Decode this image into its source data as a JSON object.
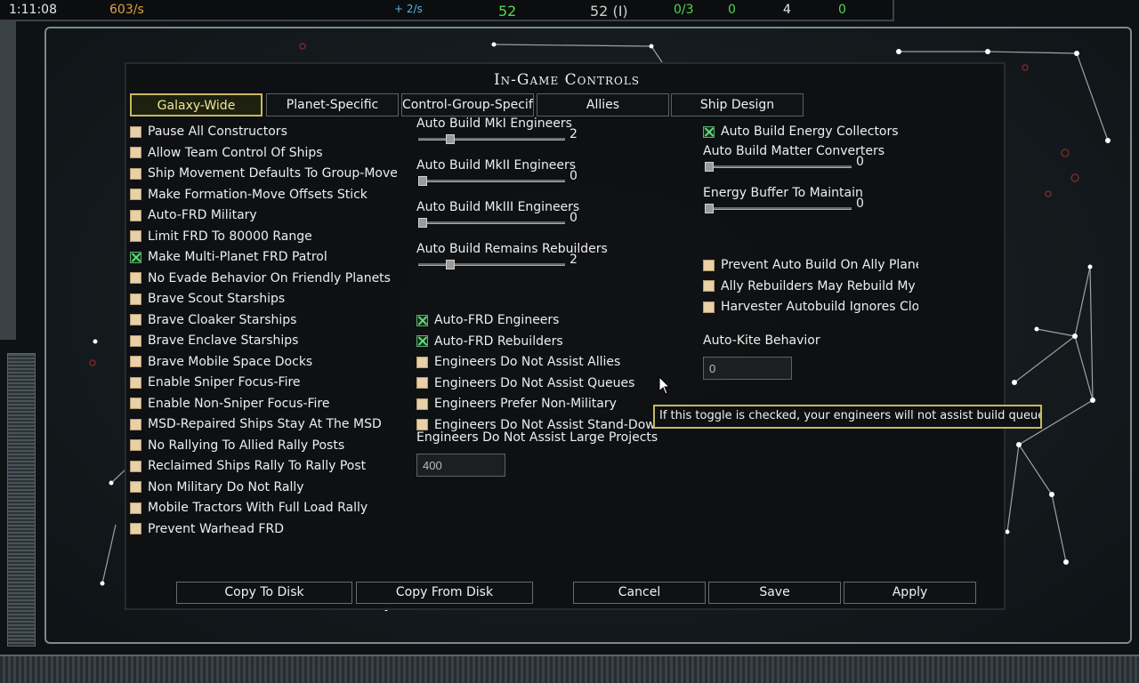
{
  "topbar": {
    "time": "1:11:08",
    "rate": "603/s",
    "energy_rate": "+ 2/s",
    "green_count": "52",
    "ship_count": "52 (I)",
    "ratio": "0/3",
    "zero_a": "0",
    "four": "4",
    "zero_b": "0"
  },
  "dialog": {
    "title": "In-Game Controls",
    "tabs": [
      "Galaxy-Wide",
      "Planet-Specific",
      "Control-Group-Specific",
      "Allies",
      "Ship Design"
    ],
    "col1": [
      {
        "label": "Pause All Constructors",
        "checked": false
      },
      {
        "label": "Allow Team Control Of Ships",
        "checked": false
      },
      {
        "label": "Ship Movement Defaults To Group-Move",
        "checked": false
      },
      {
        "label": "Make Formation-Move Offsets Stick",
        "checked": false
      },
      {
        "label": "Auto-FRD Military",
        "checked": false
      },
      {
        "label": "Limit FRD To 80000 Range",
        "checked": false
      },
      {
        "label": "Make Multi-Planet FRD Patrol",
        "checked": true
      },
      {
        "label": "No Evade Behavior On Friendly Planets",
        "checked": false
      },
      {
        "label": "Brave Scout Starships",
        "checked": false
      },
      {
        "label": "Brave Cloaker Starships",
        "checked": false
      },
      {
        "label": "Brave Enclave Starships",
        "checked": false
      },
      {
        "label": "Brave Mobile Space Docks",
        "checked": false
      },
      {
        "label": "Enable Sniper Focus-Fire",
        "checked": false
      },
      {
        "label": "Enable Non-Sniper Focus-Fire",
        "checked": false
      },
      {
        "label": "MSD-Repaired Ships Stay At The MSD",
        "checked": false
      },
      {
        "label": "No Rallying To Allied Rally Posts",
        "checked": false
      },
      {
        "label": "Reclaimed Ships Rally To Rally Post",
        "checked": false
      },
      {
        "label": "Non Military Do Not Rally",
        "checked": false
      },
      {
        "label": "Mobile Tractors With Full Load Rally",
        "checked": false
      },
      {
        "label": "Prevent Warhead FRD",
        "checked": false
      }
    ],
    "col2_sliders": [
      {
        "label": "Auto Build MkI Engineers",
        "value": "2",
        "fraction": 0.2
      },
      {
        "label": "Auto Build MkII Engineers",
        "value": "0",
        "fraction": 0
      },
      {
        "label": "Auto Build MkIII Engineers",
        "value": "0",
        "fraction": 0
      },
      {
        "label": "Auto Build Remains Rebuilders",
        "value": "2",
        "fraction": 0.2
      }
    ],
    "col2_checks": [
      {
        "label": "Auto-FRD Engineers",
        "checked": true
      },
      {
        "label": "Auto-FRD Rebuilders",
        "checked": true
      },
      {
        "label": "Engineers Do Not Assist Allies",
        "checked": false
      },
      {
        "label": "Engineers Do Not Assist Queues",
        "checked": false
      },
      {
        "label": "Engineers Prefer Non-Military",
        "checked": false
      },
      {
        "label": "Engineers Do Not Assist Stand-Down Sh",
        "checked": false
      }
    ],
    "large_projects": {
      "label": "Engineers Do Not Assist Large Projects",
      "value": "400"
    },
    "col3_energy": {
      "label": "Auto Build Energy Collectors",
      "checked": true
    },
    "col3_sliders": [
      {
        "label": "Auto Build Matter Converters",
        "value": "0",
        "fraction": 0
      },
      {
        "label": "Energy Buffer To Maintain",
        "value": "0",
        "fraction": 0
      }
    ],
    "col3_checks": [
      {
        "label": "Prevent Auto Build On Ally Planets",
        "checked": false
      },
      {
        "label": "Ally Rebuilders May Rebuild My Units",
        "checked": false
      },
      {
        "label": "Harvester Autobuild Ignores Cloakers",
        "checked": false
      }
    ],
    "kite": {
      "label": "Auto-Kite Behavior",
      "value": "0"
    },
    "buttons": {
      "copy_to": "Copy To Disk",
      "copy_from": "Copy From Disk",
      "cancel": "Cancel",
      "save": "Save",
      "apply": "Apply"
    },
    "tooltip": "If this toggle is checked, your engineers will not assist build queues."
  },
  "colors": {
    "accent_gold": "#c8b860",
    "check_green": "#5de07a",
    "topbar_green": "#4fd94f",
    "topbar_blue": "#4fb8e8",
    "topbar_orange": "#e0a040"
  }
}
